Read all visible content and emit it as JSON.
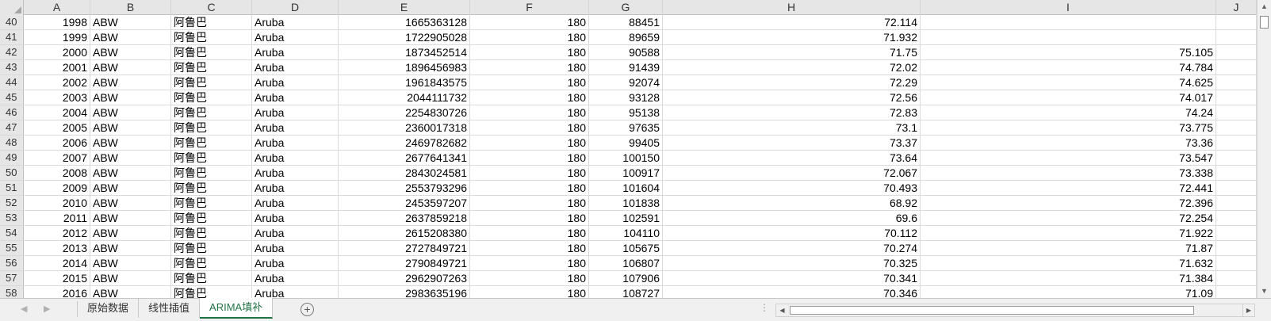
{
  "columns": [
    "A",
    "B",
    "C",
    "D",
    "E",
    "F",
    "G",
    "H",
    "I",
    "J"
  ],
  "rows": [
    {
      "n": "40",
      "A": "1998",
      "B": "ABW",
      "C": "阿鲁巴",
      "D": "Aruba",
      "E": "1665363128",
      "F": "180",
      "G": "88451",
      "H": "72.114",
      "I": ""
    },
    {
      "n": "41",
      "A": "1999",
      "B": "ABW",
      "C": "阿鲁巴",
      "D": "Aruba",
      "E": "1722905028",
      "F": "180",
      "G": "89659",
      "H": "71.932",
      "I": ""
    },
    {
      "n": "42",
      "A": "2000",
      "B": "ABW",
      "C": "阿鲁巴",
      "D": "Aruba",
      "E": "1873452514",
      "F": "180",
      "G": "90588",
      "H": "71.75",
      "I": "75.105"
    },
    {
      "n": "43",
      "A": "2001",
      "B": "ABW",
      "C": "阿鲁巴",
      "D": "Aruba",
      "E": "1896456983",
      "F": "180",
      "G": "91439",
      "H": "72.02",
      "I": "74.784"
    },
    {
      "n": "44",
      "A": "2002",
      "B": "ABW",
      "C": "阿鲁巴",
      "D": "Aruba",
      "E": "1961843575",
      "F": "180",
      "G": "92074",
      "H": "72.29",
      "I": "74.625"
    },
    {
      "n": "45",
      "A": "2003",
      "B": "ABW",
      "C": "阿鲁巴",
      "D": "Aruba",
      "E": "2044111732",
      "F": "180",
      "G": "93128",
      "H": "72.56",
      "I": "74.017"
    },
    {
      "n": "46",
      "A": "2004",
      "B": "ABW",
      "C": "阿鲁巴",
      "D": "Aruba",
      "E": "2254830726",
      "F": "180",
      "G": "95138",
      "H": "72.83",
      "I": "74.24"
    },
    {
      "n": "47",
      "A": "2005",
      "B": "ABW",
      "C": "阿鲁巴",
      "D": "Aruba",
      "E": "2360017318",
      "F": "180",
      "G": "97635",
      "H": "73.1",
      "I": "73.775"
    },
    {
      "n": "48",
      "A": "2006",
      "B": "ABW",
      "C": "阿鲁巴",
      "D": "Aruba",
      "E": "2469782682",
      "F": "180",
      "G": "99405",
      "H": "73.37",
      "I": "73.36"
    },
    {
      "n": "49",
      "A": "2007",
      "B": "ABW",
      "C": "阿鲁巴",
      "D": "Aruba",
      "E": "2677641341",
      "F": "180",
      "G": "100150",
      "H": "73.64",
      "I": "73.547"
    },
    {
      "n": "50",
      "A": "2008",
      "B": "ABW",
      "C": "阿鲁巴",
      "D": "Aruba",
      "E": "2843024581",
      "F": "180",
      "G": "100917",
      "H": "72.067",
      "I": "73.338"
    },
    {
      "n": "51",
      "A": "2009",
      "B": "ABW",
      "C": "阿鲁巴",
      "D": "Aruba",
      "E": "2553793296",
      "F": "180",
      "G": "101604",
      "H": "70.493",
      "I": "72.441"
    },
    {
      "n": "52",
      "A": "2010",
      "B": "ABW",
      "C": "阿鲁巴",
      "D": "Aruba",
      "E": "2453597207",
      "F": "180",
      "G": "101838",
      "H": "68.92",
      "I": "72.396"
    },
    {
      "n": "53",
      "A": "2011",
      "B": "ABW",
      "C": "阿鲁巴",
      "D": "Aruba",
      "E": "2637859218",
      "F": "180",
      "G": "102591",
      "H": "69.6",
      "I": "72.254"
    },
    {
      "n": "54",
      "A": "2012",
      "B": "ABW",
      "C": "阿鲁巴",
      "D": "Aruba",
      "E": "2615208380",
      "F": "180",
      "G": "104110",
      "H": "70.112",
      "I": "71.922"
    },
    {
      "n": "55",
      "A": "2013",
      "B": "ABW",
      "C": "阿鲁巴",
      "D": "Aruba",
      "E": "2727849721",
      "F": "180",
      "G": "105675",
      "H": "70.274",
      "I": "71.87"
    },
    {
      "n": "56",
      "A": "2014",
      "B": "ABW",
      "C": "阿鲁巴",
      "D": "Aruba",
      "E": "2790849721",
      "F": "180",
      "G": "106807",
      "H": "70.325",
      "I": "71.632"
    },
    {
      "n": "57",
      "A": "2015",
      "B": "ABW",
      "C": "阿鲁巴",
      "D": "Aruba",
      "E": "2962907263",
      "F": "180",
      "G": "107906",
      "H": "70.341",
      "I": "71.384"
    },
    {
      "n": "58",
      "A": "2016",
      "B": "ABW",
      "C": "阿鲁巴",
      "D": "Aruba",
      "E": "2983635196",
      "F": "180",
      "G": "108727",
      "H": "70.346",
      "I": "71.09"
    }
  ],
  "sheet_tabs": [
    {
      "label": "原始数据",
      "active": false
    },
    {
      "label": "线性插值",
      "active": false
    },
    {
      "label": "ARIMA填补",
      "active": true
    }
  ],
  "accent_color": "#217346",
  "icons": {
    "add_sheet": "plus-circle-icon",
    "scroll_up": "arrow-up-icon",
    "scroll_down": "arrow-down-icon",
    "scroll_left": "arrow-left-icon",
    "scroll_right": "arrow-right-icon"
  }
}
